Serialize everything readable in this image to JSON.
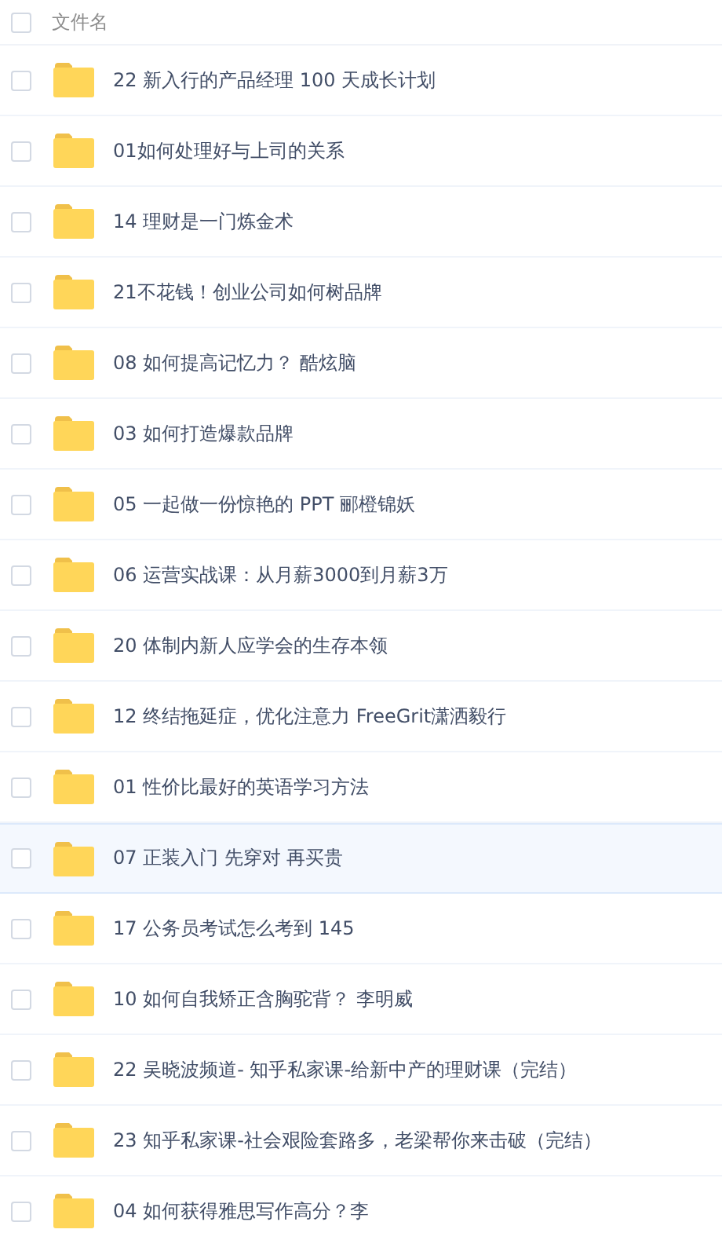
{
  "header": {
    "checked": false,
    "column_label": "文件名"
  },
  "rows": [
    {
      "name": "22 新入行的产品经理 100 天成长计划",
      "checked": false,
      "selected": false
    },
    {
      "name": "01如何处理好与上司的关系",
      "checked": false,
      "selected": false
    },
    {
      "name": "14 理财是一门炼金术",
      "checked": false,
      "selected": false
    },
    {
      "name": "21不花钱！创业公司如何树品牌",
      "checked": false,
      "selected": false
    },
    {
      "name": "08 如何提高记忆力？ 酷炫脑",
      "checked": false,
      "selected": false
    },
    {
      "name": "03 如何打造爆款品牌",
      "checked": false,
      "selected": false
    },
    {
      "name": "05 一起做一份惊艳的 PPT 郦橙锦妖",
      "checked": false,
      "selected": false
    },
    {
      "name": "06 运营实战课：从月薪3000到月薪3万",
      "checked": false,
      "selected": false
    },
    {
      "name": "20 体制内新人应学会的生存本领",
      "checked": false,
      "selected": false
    },
    {
      "name": "12 终结拖延症，优化注意力 FreeGrit潇洒毅行",
      "checked": false,
      "selected": false
    },
    {
      "name": "01 性价比最好的英语学习方法",
      "checked": false,
      "selected": false
    },
    {
      "name": "07 正装入门 先穿对 再买贵",
      "checked": false,
      "selected": true
    },
    {
      "name": "17 公务员考试怎么考到 145",
      "checked": false,
      "selected": false
    },
    {
      "name": "10 如何自我矫正含胸驼背？ 李明威",
      "checked": false,
      "selected": false
    },
    {
      "name": "22 吴晓波频道- 知乎私家课-给新中产的理财课（完结）",
      "checked": false,
      "selected": false
    },
    {
      "name": "23 知乎私家课-社会艰险套路多，老梁帮你来击破（完结）",
      "checked": false,
      "selected": false
    },
    {
      "name": "04 如何获得雅思写作高分？李",
      "checked": false,
      "selected": false
    }
  ]
}
